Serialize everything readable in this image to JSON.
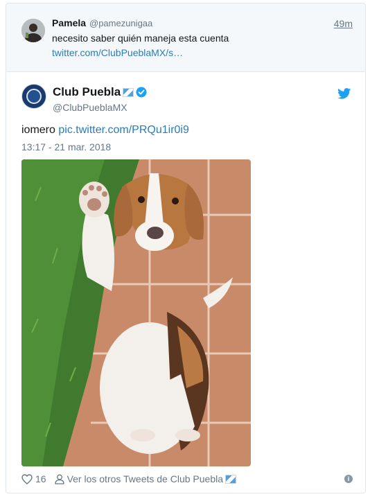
{
  "reply": {
    "name": "Pamela",
    "handle": "@pamezunigaa",
    "time": "49m",
    "text": "necesito saber quién maneja esta cuenta",
    "link": "twitter.com/ClubPueblaMX/s…"
  },
  "tweet": {
    "author_name": "Club Puebla",
    "author_handle": "@ClubPueblaMX",
    "text": "iomero",
    "link": "pic.twitter.com/PRQu1ir0i9",
    "timestamp": "13:17 - 21 mar. 2018",
    "photo_icon": "beagle-photo"
  },
  "footer": {
    "like_count": "16",
    "others_label": "Ver los otros Tweets de Club Puebla"
  },
  "colors": {
    "link": "#2b7bb9",
    "muted": "#657786",
    "reply_bg": "#f5f8fa",
    "twitter_blue": "#1da1f2"
  }
}
